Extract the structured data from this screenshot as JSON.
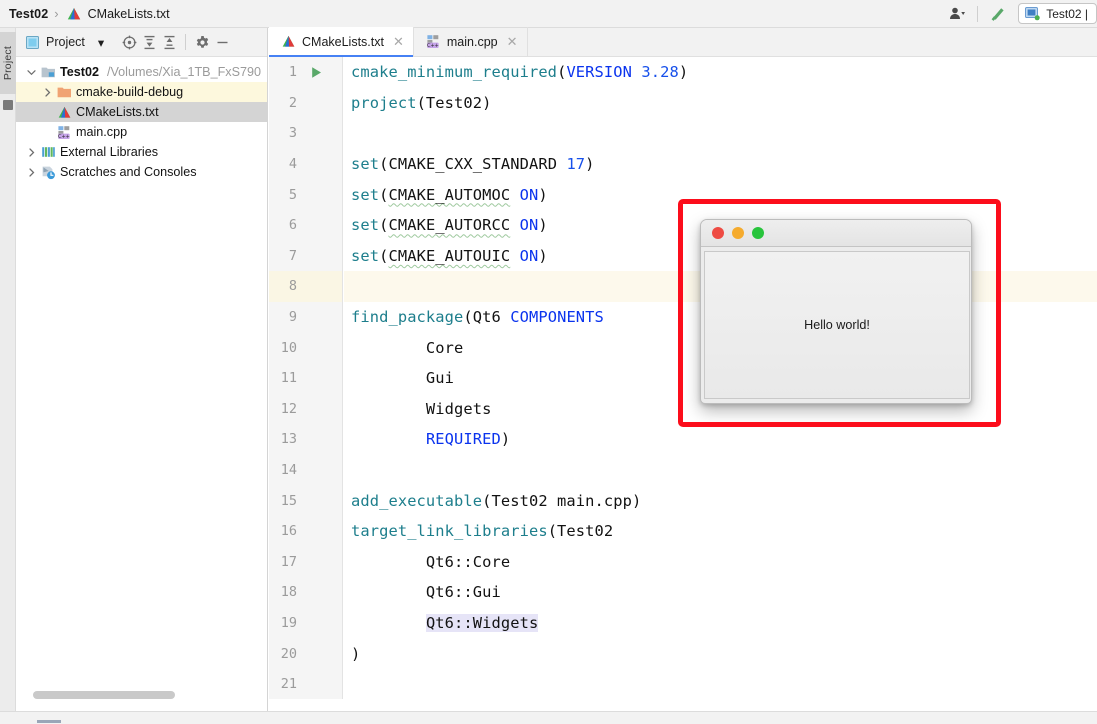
{
  "titlebar": {
    "project_name": "Test02",
    "separator": "›",
    "current_file": "CMakeLists.txt",
    "user_icon": "user-account-icon",
    "build_icon": "build-hammer-icon",
    "run_config_label": "Test02 |"
  },
  "left_strip": {
    "project_tab_label": "Project"
  },
  "project_panel": {
    "toolbar": {
      "title": "Project",
      "chevron": "▾",
      "select_target_icon": "select-opened-file-icon",
      "expand_all_icon": "expand-all-icon",
      "collapse_all_icon": "collapse-all-icon",
      "settings_icon": "gear-icon",
      "hide_icon": "minimize-icon"
    },
    "tree": [
      {
        "label": "Test02",
        "path": "/Volumes/Xia_1TB_FxS790",
        "icon": "project-module-icon",
        "arrow": "expanded",
        "bold": true,
        "indent": 0,
        "state": "none"
      },
      {
        "label": "cmake-build-debug",
        "path": "",
        "icon": "folder-icon",
        "arrow": "collapsed",
        "bold": false,
        "indent": 1,
        "state": "highlight-yellow"
      },
      {
        "label": "CMakeLists.txt",
        "path": "",
        "icon": "cmake-file-icon",
        "arrow": "none",
        "bold": false,
        "indent": 1,
        "state": "selected-grey"
      },
      {
        "label": "main.cpp",
        "path": "",
        "icon": "cpp-file-icon",
        "arrow": "none",
        "bold": false,
        "indent": 1,
        "state": "none"
      },
      {
        "label": "External Libraries",
        "path": "",
        "icon": "libraries-icon",
        "arrow": "collapsed",
        "bold": false,
        "indent": 0,
        "state": "none"
      },
      {
        "label": "Scratches and Consoles",
        "path": "",
        "icon": "scratches-icon",
        "arrow": "collapsed",
        "bold": false,
        "indent": 0,
        "state": "none"
      }
    ]
  },
  "editor": {
    "tabs": [
      {
        "label": "CMakeLists.txt",
        "icon": "cmake-file-icon",
        "active": true,
        "close": "✕"
      },
      {
        "label": "main.cpp",
        "icon": "cpp-file-icon",
        "active": false,
        "close": "✕"
      }
    ],
    "lines": [
      {
        "n": "1",
        "run_marker": true,
        "current": false
      },
      {
        "n": "2",
        "run_marker": false,
        "current": false
      },
      {
        "n": "3",
        "run_marker": false,
        "current": false
      },
      {
        "n": "4",
        "run_marker": false,
        "current": false
      },
      {
        "n": "5",
        "run_marker": false,
        "current": false
      },
      {
        "n": "6",
        "run_marker": false,
        "current": false
      },
      {
        "n": "7",
        "run_marker": false,
        "current": false
      },
      {
        "n": "8",
        "run_marker": false,
        "current": true
      },
      {
        "n": "9",
        "run_marker": false,
        "current": false
      },
      {
        "n": "10",
        "run_marker": false,
        "current": false
      },
      {
        "n": "11",
        "run_marker": false,
        "current": false
      },
      {
        "n": "12",
        "run_marker": false,
        "current": false
      },
      {
        "n": "13",
        "run_marker": false,
        "current": false
      },
      {
        "n": "14",
        "run_marker": false,
        "current": false
      },
      {
        "n": "15",
        "run_marker": false,
        "current": false
      },
      {
        "n": "16",
        "run_marker": false,
        "current": false
      },
      {
        "n": "17",
        "run_marker": false,
        "current": false
      },
      {
        "n": "18",
        "run_marker": false,
        "current": false
      },
      {
        "n": "19",
        "run_marker": false,
        "current": false
      },
      {
        "n": "20",
        "run_marker": false,
        "current": false
      },
      {
        "n": "21",
        "run_marker": false,
        "current": false
      }
    ],
    "code_text": {
      "l1_fn": "cmake_minimum_required",
      "l1_p1": "(",
      "l1_kw": "VERSION",
      "l1_sp": " ",
      "l1_num": "3.28",
      "l1_p2": ")",
      "l2_fn": "project",
      "l2_rest": "(Test02)",
      "l4_fn": "set",
      "l4_p1": "(CMAKE_CXX_STANDARD ",
      "l4_num": "17",
      "l4_p2": ")",
      "l5_fn": "set",
      "l5_p1": "(",
      "l5_warn": "CMAKE_AUTOMOC",
      "l5_sp": " ",
      "l5_kw": "ON",
      "l5_p2": ")",
      "l6_fn": "set",
      "l6_p1": "(",
      "l6_warn": "CMAKE_AUTORCC",
      "l6_sp": " ",
      "l6_kw": "ON",
      "l6_p2": ")",
      "l7_fn": "set",
      "l7_p1": "(",
      "l7_warn": "CMAKE_AUTOUIC",
      "l7_sp": " ",
      "l7_kw": "ON",
      "l7_p2": ")",
      "l9_fn": "find_package",
      "l9_p1": "(Qt6 ",
      "l9_kw": "COMPONENTS",
      "l10": "        Core",
      "l11": "        Gui",
      "l12": "        Widgets",
      "l13_pad": "        ",
      "l13_kw": "REQUIRED",
      "l13_p": ")",
      "l15_fn": "add_executable",
      "l15_rest": "(Test02 main.cpp)",
      "l16_fn": "target_link_libraries",
      "l16_rest": "(Test02",
      "l17": "        Qt6::Core",
      "l18": "        Qt6::Gui",
      "l19_pad": "        ",
      "l19_sel": "Qt6::Widgets",
      "l20": ")"
    }
  },
  "qt_window": {
    "close_button": "close-traffic-light",
    "minimize_button": "minimize-traffic-light",
    "zoom_button": "zoom-traffic-light",
    "content_label": "Hello world!"
  },
  "annotation": {
    "color": "#fc0d1b",
    "shape": "rectangle-highlight"
  }
}
